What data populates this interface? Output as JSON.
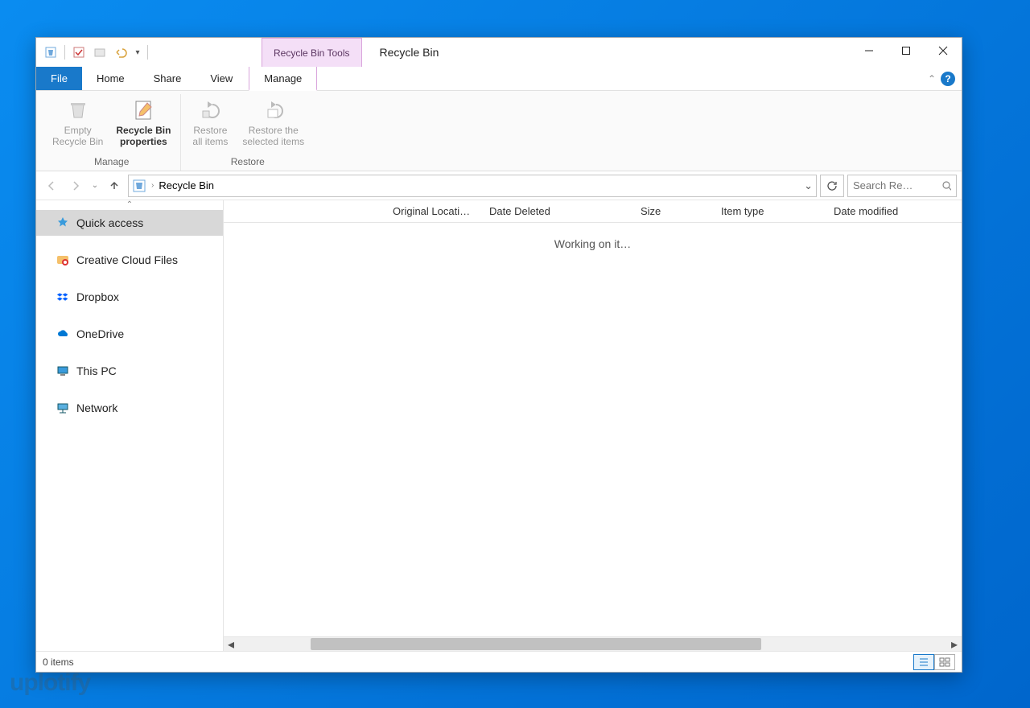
{
  "titlebar": {
    "contextual_tab": "Recycle Bin Tools",
    "title": "Recycle Bin"
  },
  "tabs": {
    "file": "File",
    "home": "Home",
    "share": "Share",
    "view": "View",
    "manage": "Manage"
  },
  "ribbon": {
    "group_manage": "Manage",
    "group_restore": "Restore",
    "empty_bin": "Empty\nRecycle Bin",
    "bin_props": "Recycle Bin\nproperties",
    "restore_all": "Restore\nall items",
    "restore_selected": "Restore the\nselected items"
  },
  "address": {
    "location": "Recycle Bin"
  },
  "search": {
    "placeholder": "Search Re…"
  },
  "sidebar": {
    "items": [
      {
        "label": "Quick access",
        "icon": "star",
        "selected": true
      },
      {
        "label": "Creative Cloud Files",
        "icon": "cc"
      },
      {
        "label": "Dropbox",
        "icon": "dropbox"
      },
      {
        "label": "OneDrive",
        "icon": "onedrive"
      },
      {
        "label": "This PC",
        "icon": "pc"
      },
      {
        "label": "Network",
        "icon": "network"
      }
    ]
  },
  "columns": [
    {
      "label": "Original Locati…",
      "width": 120
    },
    {
      "label": "Date Deleted",
      "width": 188
    },
    {
      "label": "Size",
      "width": 100
    },
    {
      "label": "Item type",
      "width": 140
    },
    {
      "label": "Date modified",
      "width": 140
    }
  ],
  "content": {
    "loading_text": "Working on it…"
  },
  "statusbar": {
    "item_count": "0 items"
  },
  "watermark": "uplotify"
}
